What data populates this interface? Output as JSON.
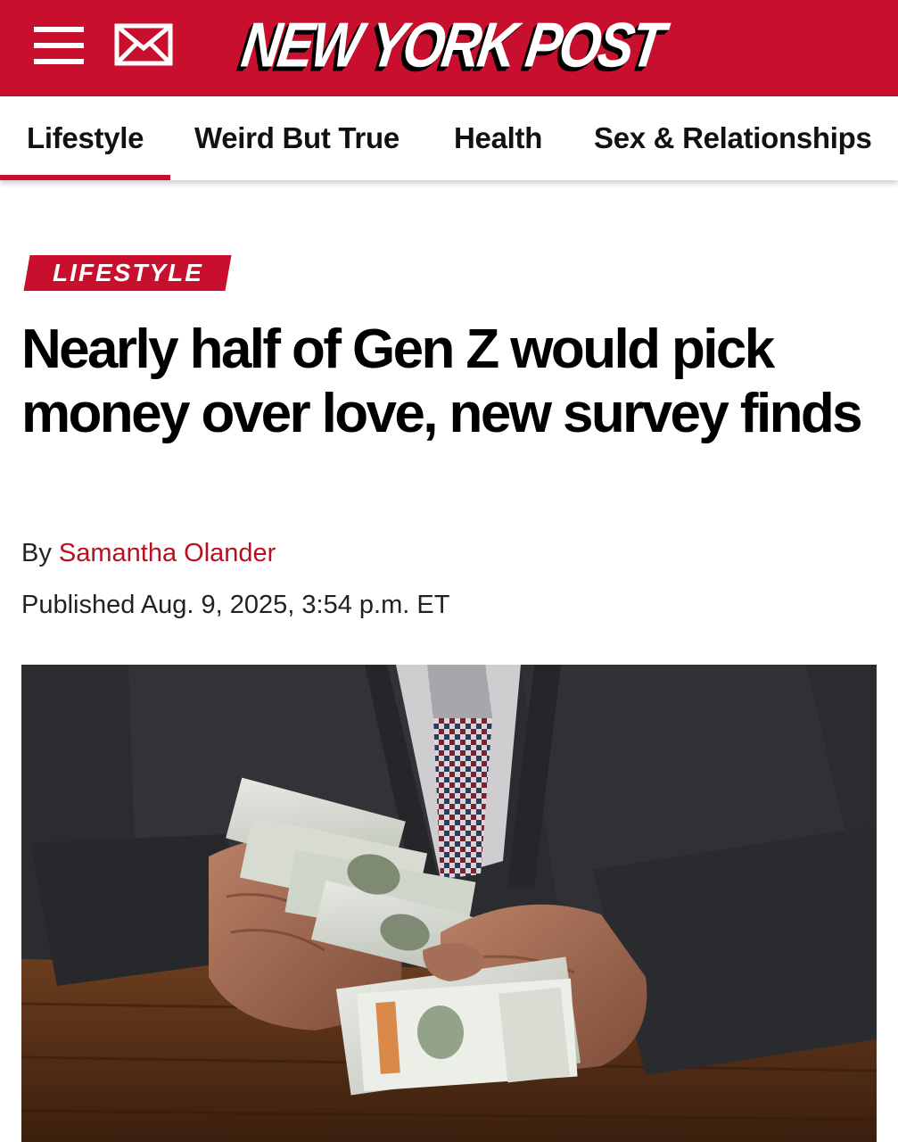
{
  "header": {
    "logo_text": "NEW YORK POST",
    "brand_color": "#c8102e",
    "menu_icon": "hamburger-menu-icon",
    "mail_icon": "mail-icon"
  },
  "nav": {
    "items": [
      {
        "label": "Lifestyle",
        "active": true
      },
      {
        "label": "Weird But True"
      },
      {
        "label": "Health"
      },
      {
        "label": "Sex & Relationships"
      }
    ]
  },
  "article": {
    "category": "LIFESTYLE",
    "headline": "Nearly half of Gen Z would pick money over love, new survey finds",
    "by_prefix": "By",
    "author": "Samantha Olander",
    "published": "Published Aug. 9, 2025, 3:54 p.m. ET"
  }
}
